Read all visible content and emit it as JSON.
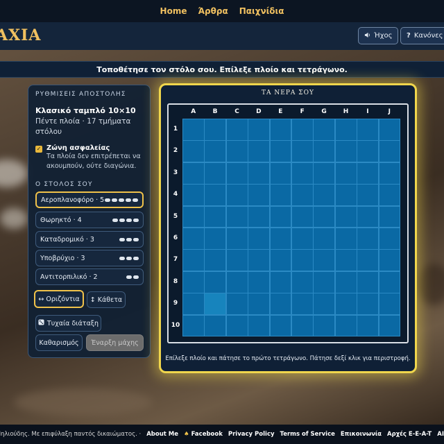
{
  "nav": {
    "home": "Home",
    "articles": "Άρθρα",
    "games": "Παιχνίδια"
  },
  "header": {
    "logo": "AXIA",
    "sound": "Ήχος",
    "rules": "Κανόνες"
  },
  "banner": "Τοποθέτησε τον στόλο σου. Επίλεξε πλοίο και τετράγωνο.",
  "settings": {
    "title": "ΡΥΘΜΙΣΕΙΣ ΑΠΟΣΤΟΛΗΣ",
    "mode_title": "Κλασικό ταμπλό 10×10",
    "mode_sub": "Πέντε πλοία · 17 τμήματα στόλου",
    "safety_title": "Ζώνη ασφαλείας",
    "safety_desc": "Τα πλοία δεν επιτρέπεται να ακουμπούν, ούτε διαγώνια.",
    "safety_checked": true
  },
  "fleet": {
    "title": "Ο ΣΤΟΛΟΣ ΣΟΥ",
    "ships": [
      {
        "label": "Αεροπλανοφόρο · 5",
        "size": 5,
        "selected": true
      },
      {
        "label": "Θωρηκτό · 4",
        "size": 4,
        "selected": false
      },
      {
        "label": "Καταδρομικό · 3",
        "size": 3,
        "selected": false
      },
      {
        "label": "Υποβρύχιο · 3",
        "size": 3,
        "selected": false
      },
      {
        "label": "Αντιτορπιλικό · 2",
        "size": 2,
        "selected": false
      }
    ]
  },
  "controls": {
    "horizontal": "↔ Οριζόντια",
    "vertical": "↕ Κάθετα",
    "random": "Τυχαία διάταξη",
    "clear": "Καθαρισμός",
    "start": "Έναρξη μάχης"
  },
  "board": {
    "title": "ΤΑ ΝΕΡΑ ΣΟΥ",
    "columns": [
      "A",
      "B",
      "C",
      "D",
      "E",
      "F",
      "G",
      "H",
      "I",
      "J"
    ],
    "rows": [
      "1",
      "2",
      "3",
      "4",
      "5",
      "6",
      "7",
      "8",
      "9",
      "10"
    ],
    "highlighted_cell": "B9",
    "hint": "Επίλεξε πλοίο και πάτησε το πρώτο τετράγωνο. Πάτησε δεξί κλικ για περιστροφή."
  },
  "footer": {
    "copyright": "ς Μηλιούδης. Με επιφύλαξη παντός δικαιώματος. ·",
    "links": [
      "About Me",
      "Facebook",
      "Privacy Policy",
      "Terms of Service",
      "Επικοινωνία",
      "Αρχές E-E-A-T",
      "AI & Ανθρ"
    ]
  },
  "colors": {
    "accent": "#f0c24a",
    "water": "#0a69a4",
    "panel": "#102034"
  }
}
